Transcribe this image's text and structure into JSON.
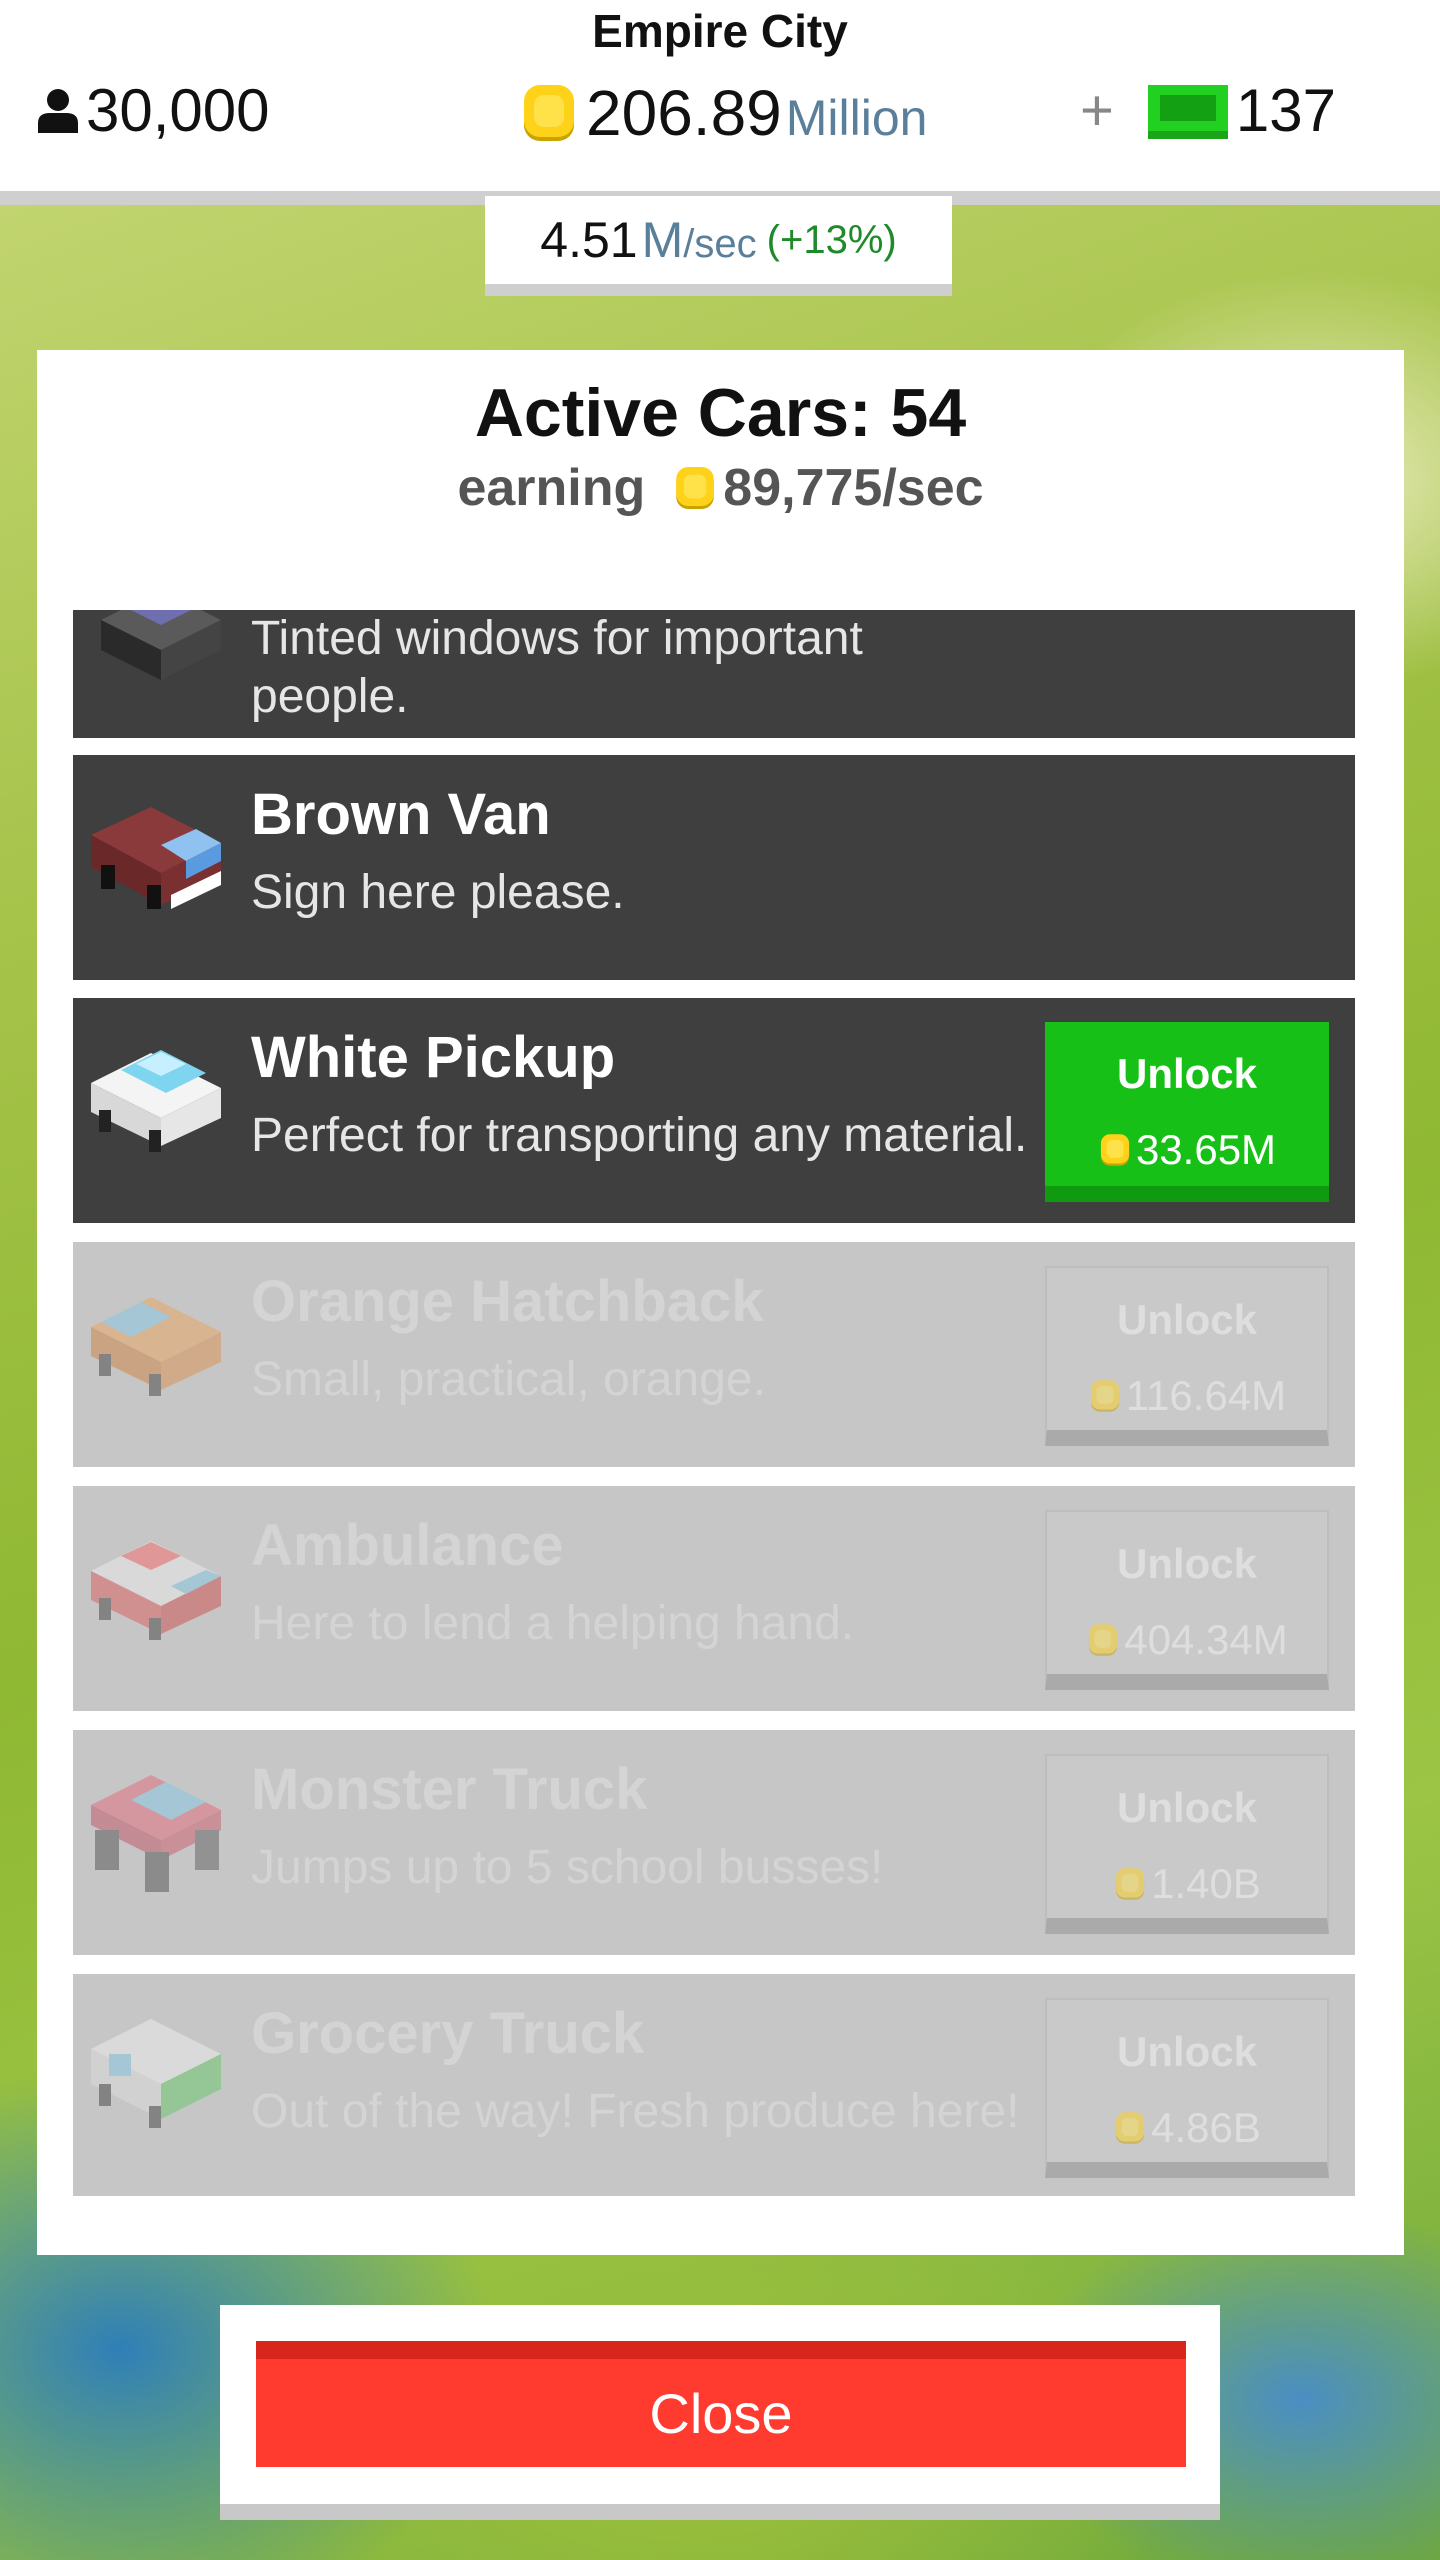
{
  "header": {
    "city_name": "Empire City",
    "population": "30,000",
    "money_value": "206.89",
    "money_unit": "Million",
    "gems_plus": "+",
    "gems_value": "137"
  },
  "rate": {
    "value": "4.51",
    "unit_m": "M",
    "unit_sec": "/sec",
    "bonus": "(+13%)"
  },
  "panel": {
    "title": "Active Cars: 54",
    "earning_label": "earning",
    "earning_value": "89,775/sec"
  },
  "cars": [
    {
      "name": "",
      "desc_line1": "Tinted windows for important",
      "desc_line2": "people.",
      "state": "owned"
    },
    {
      "name": "Brown Van",
      "desc": "Sign here please.",
      "state": "owned"
    },
    {
      "name": "White Pickup",
      "desc": "Perfect for transporting any material.",
      "state": "unlockable",
      "button": "Unlock",
      "price": "33.65M"
    },
    {
      "name": "Orange Hatchback",
      "desc": "Small, practical, orange.",
      "state": "locked",
      "button": "Unlock",
      "price": "116.64M"
    },
    {
      "name": "Ambulance",
      "desc": "Here to lend a helping hand.",
      "state": "locked",
      "button": "Unlock",
      "price": "404.34M"
    },
    {
      "name": "Monster Truck",
      "desc": "Jumps up to 5 school busses!",
      "state": "locked",
      "button": "Unlock",
      "price": "1.40B"
    },
    {
      "name": "Grocery Truck",
      "desc": "Out of the way! Fresh produce here!",
      "state": "locked",
      "button": "Unlock",
      "price": "4.86B"
    }
  ],
  "close_label": "Close",
  "icons": {
    "population": "person-icon",
    "money": "coin-icon",
    "gems": "cash-icon"
  },
  "colors": {
    "unlock_green": "#17c017",
    "close_red": "#ff3b30",
    "row_dark": "#3f3f3f",
    "row_locked": "#c6c6c6"
  }
}
